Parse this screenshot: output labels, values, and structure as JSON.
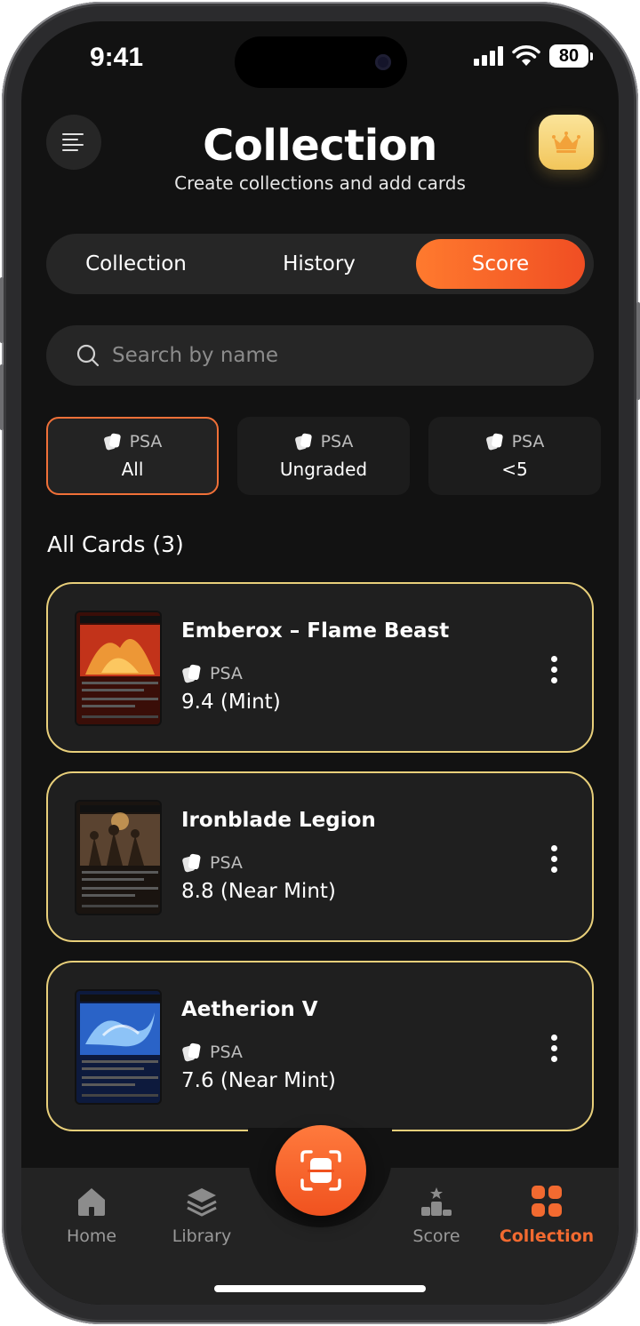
{
  "status_bar": {
    "time": "9:41",
    "battery": "80"
  },
  "header": {
    "title": "Collection",
    "subtitle": "Create collections and add cards"
  },
  "tabs": [
    {
      "label": "Collection",
      "active": false
    },
    {
      "label": "History",
      "active": false
    },
    {
      "label": "Score",
      "active": true
    }
  ],
  "search": {
    "placeholder": "Search by name",
    "value": ""
  },
  "filters": [
    {
      "grader": "PSA",
      "label": "All",
      "active": true
    },
    {
      "grader": "PSA",
      "label": "Ungraded",
      "active": false
    },
    {
      "grader": "PSA",
      "label": "<5",
      "active": false
    }
  ],
  "section": {
    "title": "All Cards (3)"
  },
  "cards": [
    {
      "name": "Emberox – Flame Beast",
      "grader": "PSA",
      "grade": "9.4 (Mint)",
      "art": "fire",
      "art_colors": [
        "#f2a23a",
        "#c2331a",
        "#3a0e08"
      ]
    },
    {
      "name": "Ironblade Legion",
      "grader": "PSA",
      "grade": "8.8 (Near Mint)",
      "art": "warriors",
      "art_colors": [
        "#b58b57",
        "#5a4330",
        "#1a1410"
      ]
    },
    {
      "name": "Aetherion V",
      "grader": "PSA",
      "grade": "7.6 (Near Mint)",
      "art": "dragon",
      "art_colors": [
        "#9fd4ff",
        "#2a63c7",
        "#0d1a3d"
      ]
    }
  ],
  "bottom_nav": [
    {
      "label": "Home",
      "icon": "home-icon",
      "active": false
    },
    {
      "label": "Library",
      "icon": "layers-icon",
      "active": false
    },
    {
      "label": "Score",
      "icon": "podium-icon",
      "active": false
    },
    {
      "label": "Collection",
      "icon": "grid-icon",
      "active": true
    }
  ],
  "colors": {
    "accent": "#f26a30",
    "card_border": "#e8cf7a",
    "background": "#121212"
  }
}
